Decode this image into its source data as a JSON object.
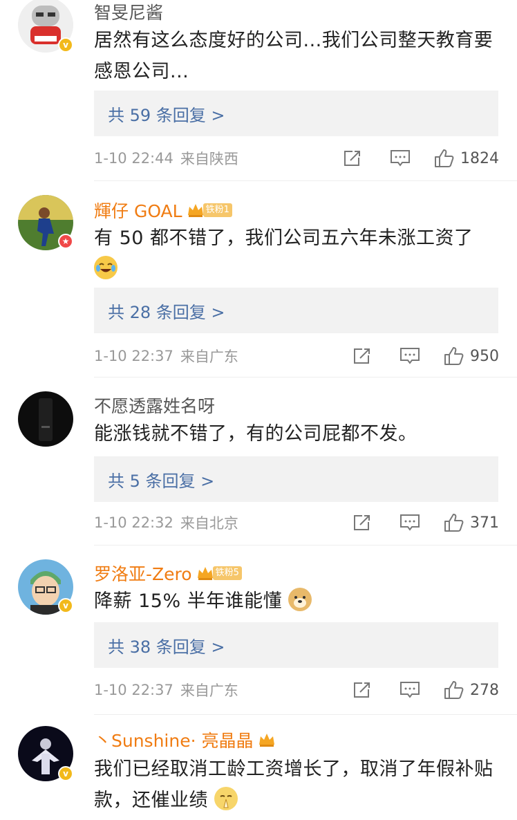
{
  "comments": [
    {
      "username": "智旻尼酱",
      "text": "居然有这么态度好的公司...我们公司整天教育要感恩公司...",
      "replies": "共 59 条回复 >",
      "time": "1-10 22:44",
      "location": "来自陕西",
      "likes": "1824"
    },
    {
      "username": "輝仔 GOAL",
      "fan_badge": "铁粉1",
      "text": "有 50 都不错了，我们公司五六年未涨工资了",
      "replies": "共 28 条回复 >",
      "time": "1-10 22:37",
      "location": "来自广东",
      "likes": "950"
    },
    {
      "username": "不愿透露姓名呀",
      "text": "能涨钱就不错了，有的公司屁都不发。",
      "replies": "共 5 条回复 >",
      "time": "1-10 22:32",
      "location": "来自北京",
      "likes": "371"
    },
    {
      "username": "罗洛亚-Zero",
      "fan_badge": "铁粉5",
      "text": "降薪 15% 半年谁能懂",
      "replies": "共 38 条回复 >",
      "time": "1-10 22:37",
      "location": "来自广东",
      "likes": "278"
    },
    {
      "username": "丶Sunshine· 亮晶晶",
      "text": "我们已经取消工龄工资增长了，取消了年假补贴款，还催业绩"
    }
  ],
  "colors": {
    "vip_name": "#f07c12",
    "reply_link": "#4a6fa5",
    "reply_bg": "#f2f2f2",
    "meta": "#999999"
  }
}
